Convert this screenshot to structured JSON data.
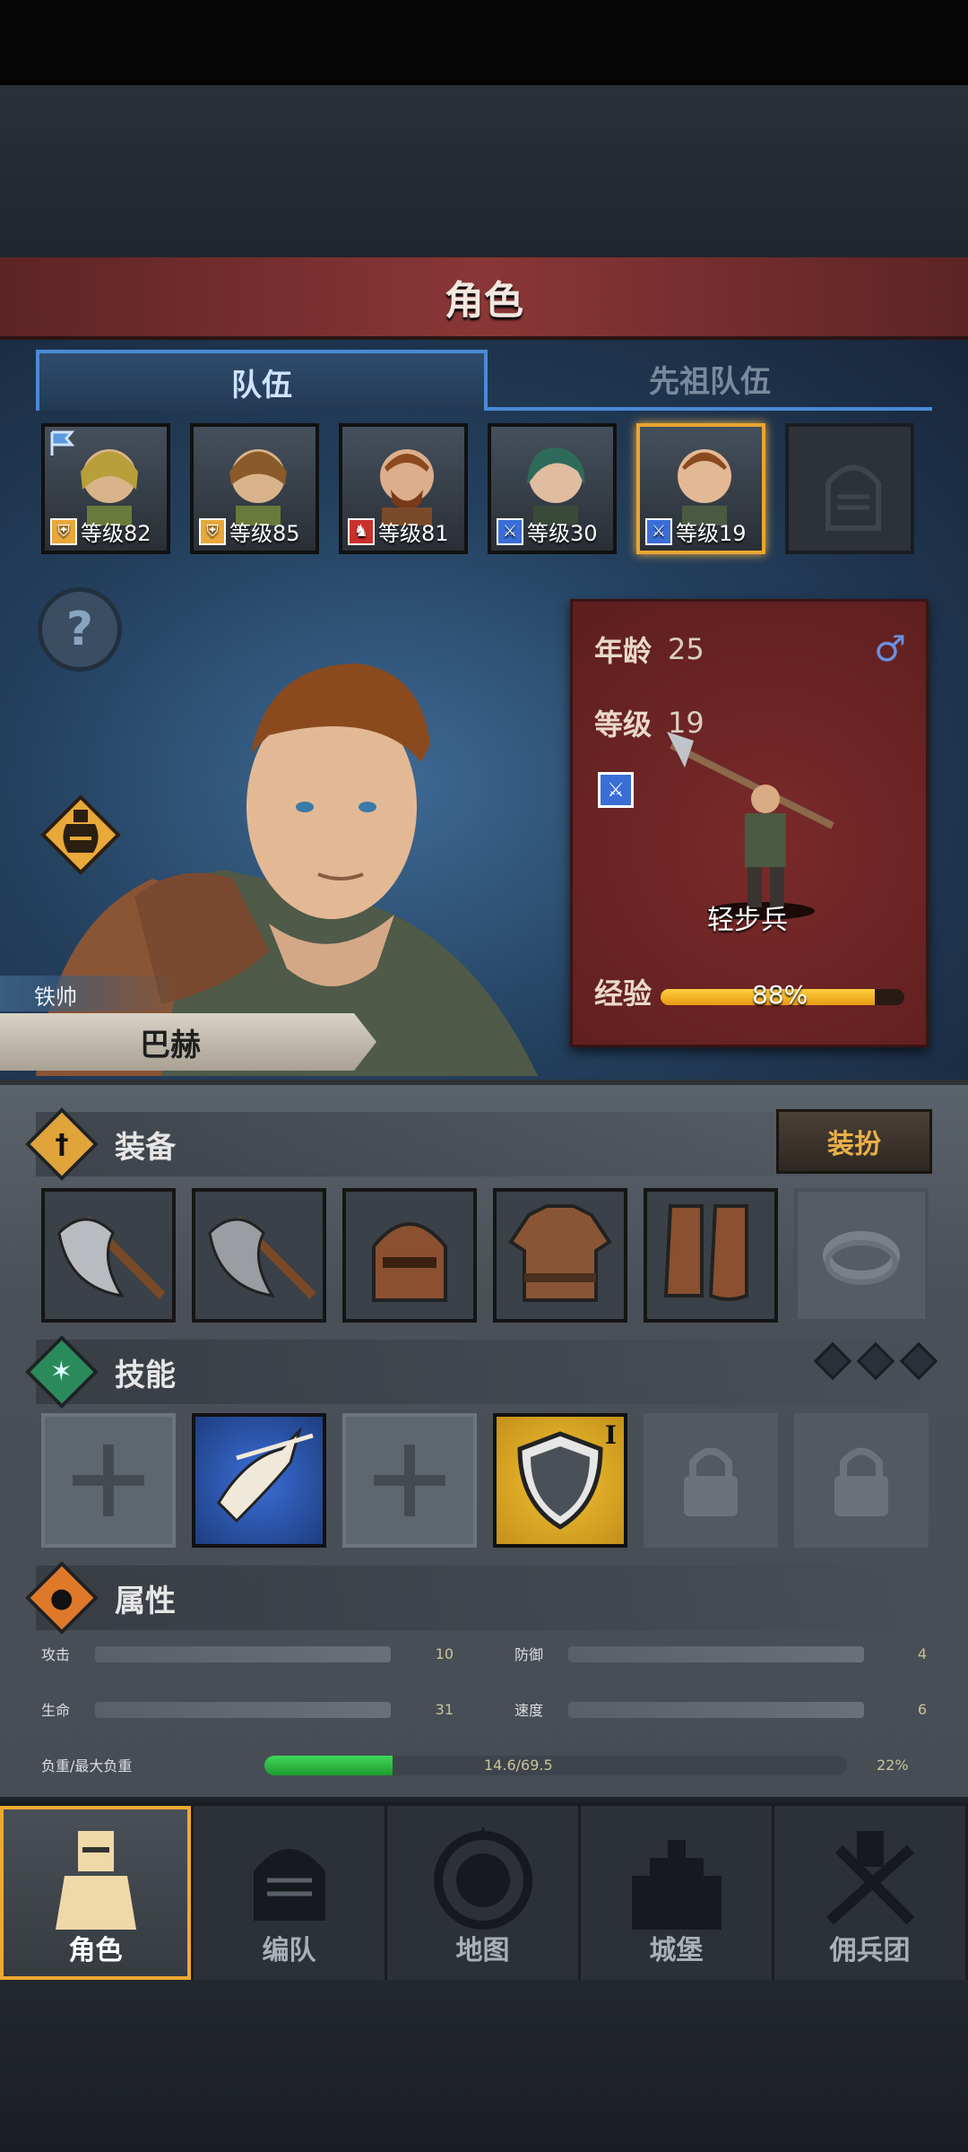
{
  "header": {
    "title": "角色"
  },
  "tabs": [
    {
      "label": "队伍",
      "active": true
    },
    {
      "label": "先祖队伍",
      "active": false
    }
  ],
  "roster": [
    {
      "level": "等级82",
      "class_icon": "shield-icon",
      "flag": true
    },
    {
      "level": "等级85",
      "class_icon": "shield-icon"
    },
    {
      "level": "等级81",
      "class_icon": "horse-icon"
    },
    {
      "level": "等级30",
      "class_icon": "sword-icon"
    },
    {
      "level": "等级19",
      "class_icon": "sword-icon",
      "selected": true
    },
    {
      "level": "",
      "class_icon": "helmet-icon",
      "empty": true
    }
  ],
  "hero": {
    "title": "铁帅",
    "name": "巴赫",
    "age_label": "年龄",
    "age": "25",
    "level_label": "等级",
    "level": "19",
    "gender_symbol": "♂",
    "unit_class": "轻步兵",
    "xp_label": "经验",
    "xp_percent": 88,
    "xp_text": "88%"
  },
  "equipment": {
    "label": "装备",
    "dress_button": "装扮",
    "slots": [
      "axe-icon",
      "axe-icon",
      "helmet-icon",
      "armor-icon",
      "boots-icon",
      "ring-icon"
    ]
  },
  "skills": {
    "label": "技能",
    "tier_numeral": "I"
  },
  "attributes": {
    "label": "属性",
    "attack_label": "攻击",
    "attack": "10",
    "defense_label": "防御",
    "defense": "4",
    "hp_label": "生命",
    "hp": "31",
    "speed_label": "速度",
    "speed": "6",
    "load_label": "负重/最大负重",
    "load_text": "14.6/69.5",
    "load_percent_text": "22%",
    "load_percent": 22
  },
  "nav": [
    {
      "label": "角色",
      "active": true
    },
    {
      "label": "编队"
    },
    {
      "label": "地图"
    },
    {
      "label": "城堡"
    },
    {
      "label": "佣兵团"
    }
  ],
  "colors": {
    "accent": "#f0a930",
    "tab_blue": "#4a8ad6",
    "header_red": "#8a3636",
    "xp": "#f0b030",
    "load": "#2fc24a"
  }
}
